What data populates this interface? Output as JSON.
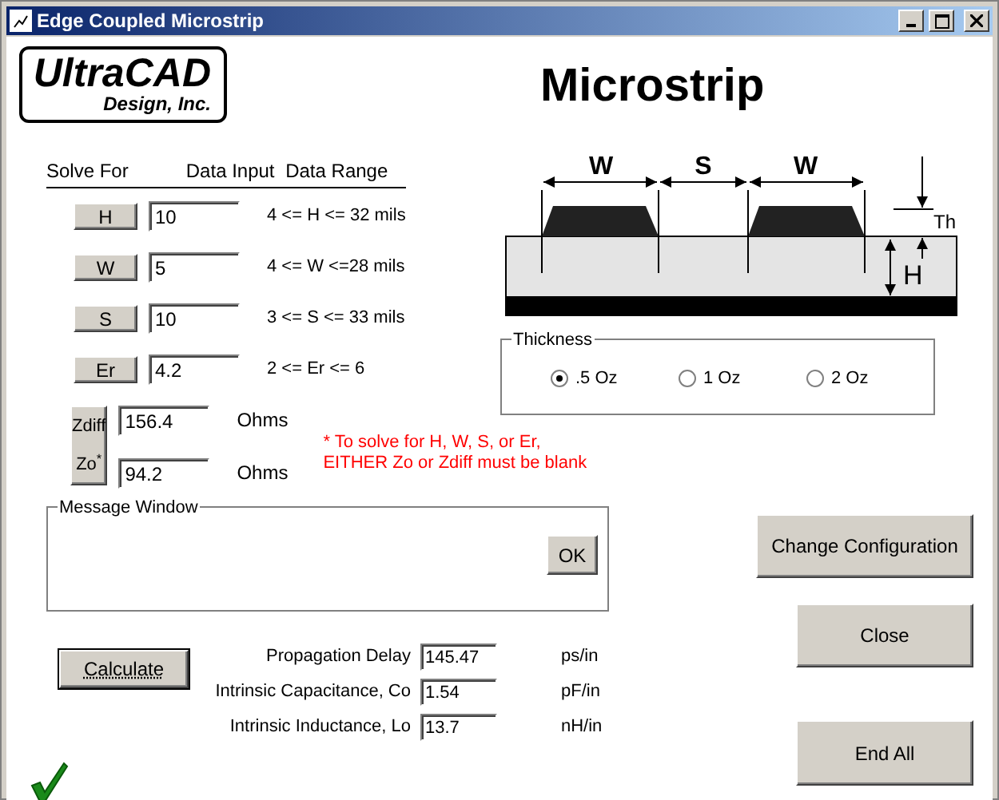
{
  "window": {
    "title": "Edge Coupled Microstrip"
  },
  "logo": {
    "name": "UltraCAD",
    "subtitle": "Design, Inc."
  },
  "heading": "Microstrip",
  "solve_table": {
    "columns": [
      "Solve For",
      "Data Input",
      "Data Range"
    ],
    "rows": [
      {
        "button": "H",
        "value": "10",
        "range": "4 <= H <= 32 mils"
      },
      {
        "button": "W",
        "value": "5",
        "range": "4 <= W <=28 mils"
      },
      {
        "button": "S",
        "value": "10",
        "range": "3 <= S <= 33 mils"
      },
      {
        "button": "Er",
        "value": "4.2",
        "range": "2 <= Er <= 6"
      }
    ],
    "impedance_button": [
      "Zdiff",
      "Zo$^{*}$"
    ],
    "impedance_rows": [
      {
        "value": "156.4",
        "unit": "Ohms"
      },
      {
        "value": "94.2",
        "unit": "Ohms"
      }
    ]
  },
  "note": [
    "* To solve for H, W, S, or Er,",
    "EITHER Zo or Zdiff must be blank"
  ],
  "diagram": {
    "labels": [
      "W",
      "S",
      "W",
      "Th",
      "H"
    ]
  },
  "thickness": {
    "title": "Thickness",
    "options": [
      {
        "label": ".5 Oz",
        "selected": true
      },
      {
        "label": "1 Oz",
        "selected": false
      },
      {
        "label": "2 Oz",
        "selected": false
      }
    ]
  },
  "message_window": {
    "title": "Message Window",
    "button": "OK"
  },
  "calculate": {
    "label": "Calculate",
    "default": true
  },
  "results": [
    {
      "label": "Propagation Delay",
      "value": "145.47",
      "unit": "ps/in"
    },
    {
      "label": "Intrinsic Capacitance, Co",
      "value": "1.54",
      "unit": "pF/in"
    },
    {
      "label": "Intrinsic Inductance, Lo",
      "value": "13.7",
      "unit": "nH/in"
    }
  ],
  "buttons": [
    "Change Configuration",
    "Close",
    "End All"
  ]
}
